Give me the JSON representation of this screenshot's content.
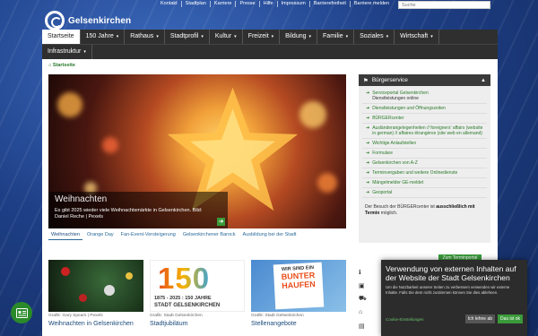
{
  "brand": {
    "name": "Gelsenkirchen",
    "accent": "#2e8b2e",
    "nav_bg": "#2f2f2f"
  },
  "toplinks": [
    "Kontakt",
    "Stadtplan",
    "Karriere",
    "Presse",
    "Hilfe",
    "Impressum",
    "Barrierefreiheit",
    "Barriere melden"
  ],
  "search": {
    "placeholder": "Suche"
  },
  "nav": {
    "row1": [
      {
        "label": "Startseite",
        "active": true
      },
      {
        "label": "150 Jahre"
      },
      {
        "label": "Rathaus"
      },
      {
        "label": "Stadtprofil"
      },
      {
        "label": "Kultur"
      },
      {
        "label": "Freizeit"
      },
      {
        "label": "Bildung"
      },
      {
        "label": "Familie"
      },
      {
        "label": "Soziales"
      },
      {
        "label": "Wirtschaft"
      }
    ],
    "row2": [
      {
        "label": "Infrastruktur"
      }
    ]
  },
  "breadcrumb": "Startseite",
  "hero": {
    "title": "Weihnachten",
    "text": "Es gibt 2025 wieder viele Weihnachtsmärkte in Gelsenkirchen. Bild: Daniel Reche | Pexels"
  },
  "tabs": [
    {
      "label": "Weihnachten",
      "active": true
    },
    {
      "label": "Orange Day"
    },
    {
      "label": "Fan-Event-Versteigerung"
    },
    {
      "label": "Gelsenkirchener Barock"
    },
    {
      "label": "Ausbildung bei der Stadt"
    }
  ],
  "cards": [
    {
      "meta": "Grafik: Gary Spears | Pexels",
      "title": "Weihnachten in Gelsenkirchen"
    },
    {
      "meta": "Grafik: Stadt Gelsenkirchen",
      "title": "Stadtjubiläum",
      "num": "150",
      "years": "1875 - 2025 : 150 JAHRE",
      "city": "STADT GELSENKIRCHEN"
    },
    {
      "meta": "Grafik: Stadt Gelsenkirchen",
      "title": "Stellenangebote",
      "l1": "WIR SIND EIN",
      "l2": "BUNTER",
      "l3": "HAUFEN"
    }
  ],
  "panel": {
    "title": "Bürgerservice",
    "links": [
      {
        "label": "Serviceportal Gelsenkirchen",
        "sub": "Dienstleistungen online"
      },
      {
        "label": "Dienstleistungen und Öffnungszeiten"
      },
      {
        "label": "BÜRGERcenter"
      },
      {
        "label": "Ausländerangelegenheiten // foreigners' affairs (website in german) // affaires étrangères (site web en allemand)"
      },
      {
        "label": "Wichtige Anlaufstellen"
      },
      {
        "label": "Formulare"
      },
      {
        "label": "Gelsenkirchen von A-Z"
      },
      {
        "label": "Terminvergaben und weitere Onlinedienste"
      },
      {
        "label": "Mängelmelder GE-meldet"
      },
      {
        "label": "Geoportal"
      }
    ],
    "note_pre": "Der Besuch der BÜRGERcenter ist ",
    "note_bold": "ausschließlich mit Termin",
    "note_post": " möglich.",
    "button": "Zum Terminportal"
  },
  "side_icons": [
    "info-icon",
    "bus-icon",
    "car-icon",
    "building-icon",
    "trash-icon"
  ],
  "cookie": {
    "title": "Verwendung von externen Inhalten auf der Website der Stadt Gelsenkirchen",
    "body": "Um die Nutzbarkeit unserer Seiten zu verbessern verwenden wir externe Inhalte. Falls Sie dem nicht zustimmen können Sie dies ablehnen.",
    "link": "Cookie-Einstellungen",
    "deny": "Ich lehne ab",
    "ok": "Das ist ok"
  }
}
